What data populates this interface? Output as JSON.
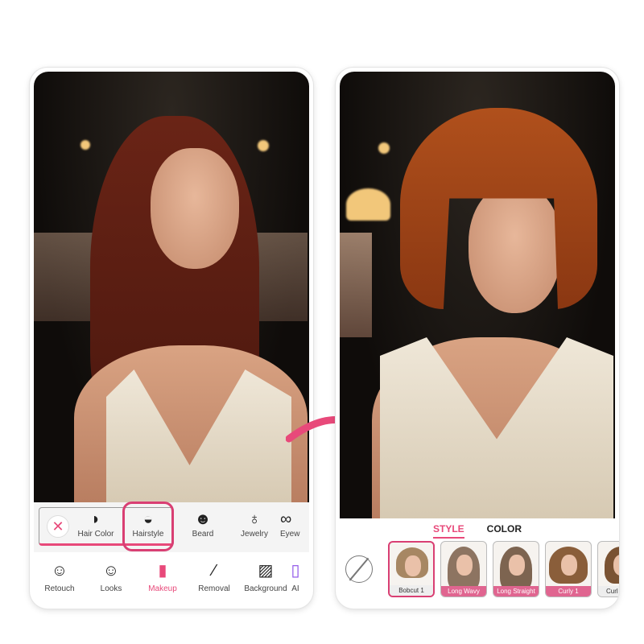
{
  "left_phone": {
    "subtoolbar": {
      "items": [
        {
          "label": "Hair Color",
          "icon": "hair-color-icon"
        },
        {
          "label": "Hairstyle",
          "icon": "hairstyle-icon",
          "selected": true
        },
        {
          "label": "Beard",
          "icon": "beard-icon"
        },
        {
          "label": "Jewelry",
          "icon": "jewelry-icon"
        },
        {
          "label": "Eyew",
          "icon": "eyewear-icon"
        }
      ]
    },
    "toolbar": {
      "items": [
        {
          "label": "Retouch",
          "icon": "retouch-icon"
        },
        {
          "label": "Looks",
          "icon": "looks-icon"
        },
        {
          "label": "Makeup",
          "icon": "lipstick-icon",
          "active": true
        },
        {
          "label": "Removal",
          "icon": "magic-wand-icon"
        },
        {
          "label": "Background",
          "icon": "background-icon"
        },
        {
          "label": "AI",
          "icon": "ai-icon"
        }
      ]
    }
  },
  "right_phone": {
    "tabs": [
      {
        "label": "STYLE",
        "active": true
      },
      {
        "label": "COLOR"
      }
    ],
    "styles": [
      {
        "label": "Bobcut 1",
        "selected": true
      },
      {
        "label": "Long Wavy"
      },
      {
        "label": "Long Straight"
      },
      {
        "label": "Curly 1"
      },
      {
        "label": "Curl"
      }
    ]
  },
  "colors": {
    "accent": "#e8497a"
  }
}
